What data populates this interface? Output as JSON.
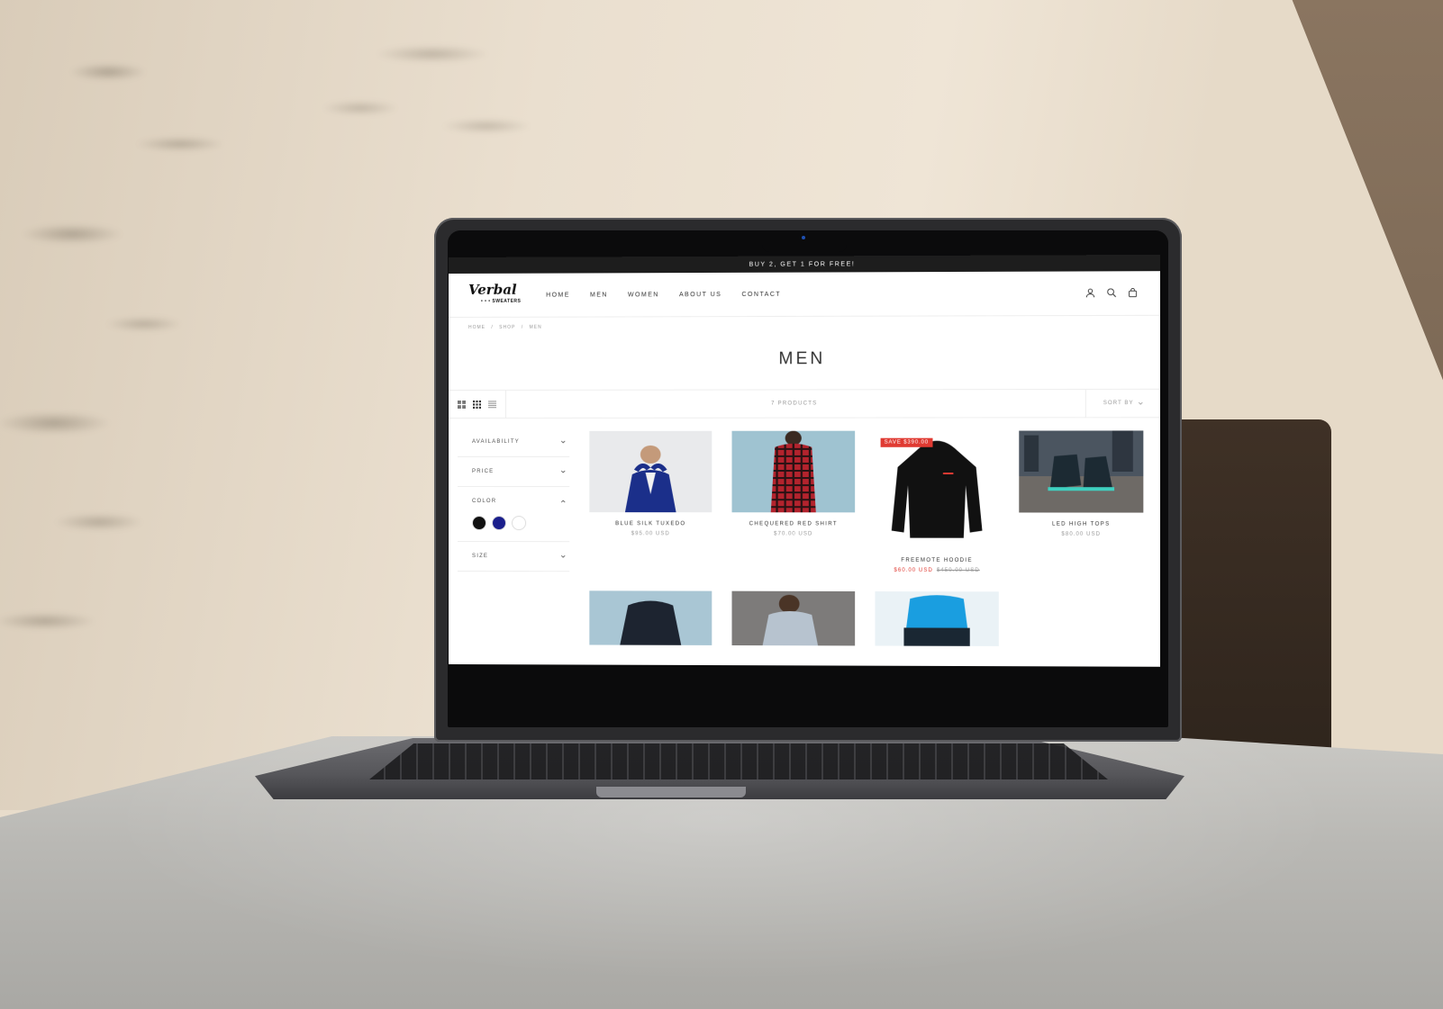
{
  "announcement": "BUY 2, GET 1 FOR FREE!",
  "brand": {
    "script": "Verbal",
    "sub": "• • • SWEATERS"
  },
  "nav": [
    "HOME",
    "MEN",
    "WOMEN",
    "ABOUT US",
    "CONTACT"
  ],
  "breadcrumb": [
    "HOME",
    "/",
    "SHOP",
    "/",
    "MEN"
  ],
  "page_title": "MEN",
  "toolbar": {
    "product_count": "7 PRODUCTS",
    "sort_label": "SORT BY"
  },
  "filters": {
    "availability": "AVAILABILITY",
    "price": "PRICE",
    "color": "COLOR",
    "size": "SIZE"
  },
  "colors": {
    "black": "#111111",
    "navy": "#1b1f8c",
    "white": "#ffffff",
    "sale": "#e03a32"
  },
  "products": [
    {
      "name": "BLUE SILK TUXEDO",
      "price": "$95.00 USD"
    },
    {
      "name": "CHEQUERED RED SHIRT",
      "price": "$70.00 USD"
    },
    {
      "name": "FREEMOTE HOODIE",
      "badge": "SAVE $390.00",
      "price": "$60.00 USD",
      "compare_price": "$450.00 USD"
    },
    {
      "name": "LED HIGH TOPS",
      "price": "$80.00 USD"
    }
  ]
}
